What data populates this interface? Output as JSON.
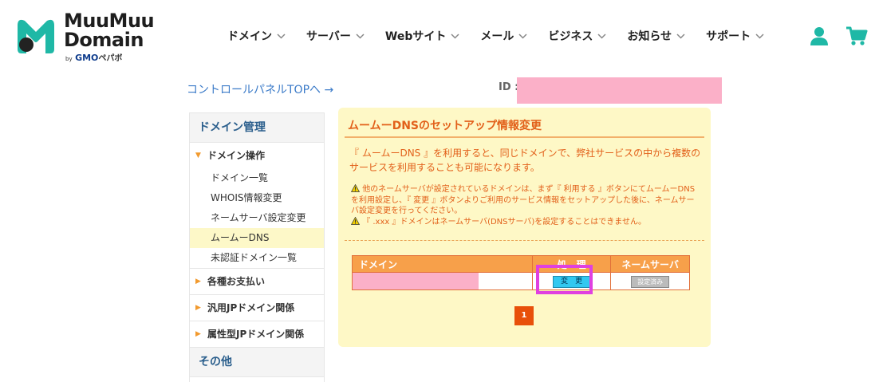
{
  "header": {
    "logo_line1": "MuuMuu",
    "logo_line2": "Domain",
    "logo_by": "by",
    "logo_gmo": "GMO",
    "logo_pepabo": "ペパボ",
    "nav": [
      {
        "label": "ドメイン"
      },
      {
        "label": "サーバー"
      },
      {
        "label": "Webサイト"
      },
      {
        "label": "メール"
      },
      {
        "label": "ビジネス"
      },
      {
        "label": "お知らせ"
      },
      {
        "label": "サポート"
      }
    ]
  },
  "control_panel_link": "コントロールパネルTOPへ →",
  "id_label": "ID :",
  "sidebar": {
    "section_title": "ドメイン管理",
    "group_domain_ops": "ドメイン操作",
    "items": [
      {
        "label": "ドメイン一覧"
      },
      {
        "label": "WHOIS情報変更"
      },
      {
        "label": "ネームサーバ設定変更"
      },
      {
        "label": "ムームーDNS"
      },
      {
        "label": "未認証ドメイン一覧"
      }
    ],
    "group_payments": "各種お支払い",
    "group_jp": "汎用JPドメイン関係",
    "group_attr_jp": "属性型JPドメイン関係",
    "section_other": "その他"
  },
  "panel": {
    "title": "ムームーDNSのセットアップ情報変更",
    "description": "『 ムームーDNS 』を利用すると、同じドメインで、弊社サービスの中から複数のサービスを利用することも可能になります。",
    "warning1": "他のネームサーバが設定されているドメインは、まず『 利用する 』ボタンにてムームーDNSを利用設定し、『 変更 』ボタンよりご利用のサービス情報をセットアップした後に、ネームサーバ設定変更を行ってください。",
    "warning2": "『 .xxx 』ドメインはネームサーバ(DNSサーバ)を設定することはできません。",
    "table": {
      "headers": [
        "ドメイン",
        "処　理",
        "ネームサーバ"
      ],
      "change_button": "変　更",
      "ns_button": "設定済み"
    },
    "page": "1"
  },
  "colors": {
    "accent_orange": "#e2601a",
    "teal_brand": "#1fb8a6",
    "panel_bg": "#fef8c6",
    "highlight": "#e040e0"
  }
}
